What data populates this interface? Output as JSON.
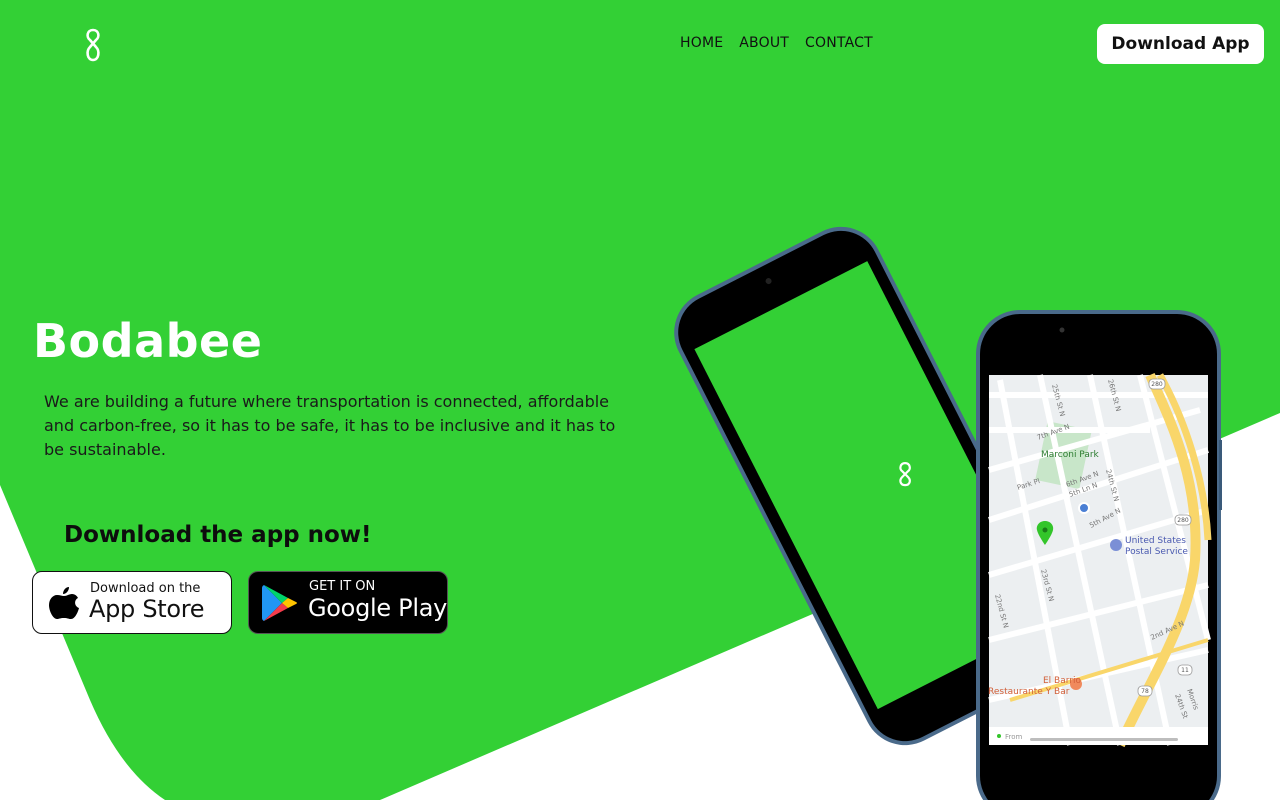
{
  "nav": {
    "links": [
      "HOME",
      "ABOUT",
      "CONTACT"
    ],
    "download_button": "Download App"
  },
  "hero": {
    "title": "Bodabee",
    "description": "We are building a future where transportation is connected, affordable and carbon-free, so it has to be safe, it has to be inclusive and it has to be sustainable.",
    "cta_heading": "Download the app now!"
  },
  "badges": {
    "app_store": {
      "small": "Download on the",
      "big": "App Store"
    },
    "google_play": {
      "small": "GET IT ON",
      "big": "Google Play"
    }
  },
  "map": {
    "labels": [
      "Marconi Park",
      "United States",
      "Postal Service",
      "El Barrio",
      "Restaurante Y Bar",
      "From"
    ],
    "streets": [
      "25th St N",
      "26th St N",
      "7th Ave N",
      "6th Ave N",
      "5th Ln N",
      "5th Ave N",
      "Park Pl",
      "24th St N",
      "23rd St N",
      "22nd St N",
      "2nd Ave N",
      "24th St",
      "Morris"
    ],
    "route_shields": [
      "280",
      "280",
      "11",
      "78"
    ]
  },
  "colors": {
    "brand_green": "#33d035",
    "white": "#ffffff",
    "phone_frame": "#4a6a8a"
  },
  "icons": [
    "bodabee-logo-icon",
    "apple-icon",
    "google-play-icon",
    "map-pin-icon",
    "location-dot-icon",
    "post-office-icon",
    "restaurant-icon"
  ]
}
